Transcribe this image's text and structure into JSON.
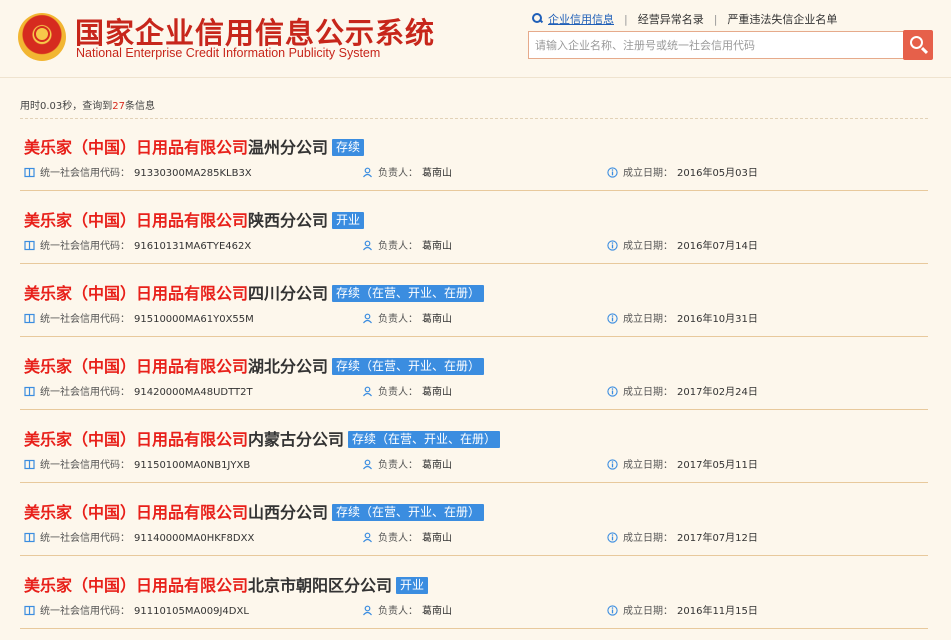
{
  "header": {
    "title_cn": "国家企业信用信息公示系统",
    "title_en": "National Enterprise Credit Information Publicity System",
    "nav": [
      "企业信用信息",
      "经营异常名录",
      "严重违法失信企业名单"
    ],
    "search_placeholder": "请输入企业名称、注册号或统一社会信用代码"
  },
  "stats": {
    "prefix": "用时0.03秒，查询到",
    "count": "27",
    "suffix": "条信息"
  },
  "labels": {
    "code": "统一社会信用代码：",
    "person": "负责人：",
    "date": "成立日期："
  },
  "results": [
    {
      "name_hl": "美乐家（中国）日用品有限公司",
      "name_rest": "温州分公司",
      "status": "存续",
      "code": "91330300MA285KLB3X",
      "person": "葛南山",
      "date": "2016年05月03日"
    },
    {
      "name_hl": "美乐家（中国）日用品有限公司",
      "name_rest": "陕西分公司",
      "status": "开业",
      "code": "91610131MA6TYE462X",
      "person": "葛南山",
      "date": "2016年07月14日"
    },
    {
      "name_hl": "美乐家（中国）日用品有限公司",
      "name_rest": "四川分公司",
      "status": "存续（在营、开业、在册）",
      "code": "91510000MA61Y0X55M",
      "person": "葛南山",
      "date": "2016年10月31日"
    },
    {
      "name_hl": "美乐家（中国）日用品有限公司",
      "name_rest": "湖北分公司",
      "status": "存续（在营、开业、在册）",
      "code": "91420000MA48UDTT2T",
      "person": "葛南山",
      "date": "2017年02月24日"
    },
    {
      "name_hl": "美乐家（中国）日用品有限公司",
      "name_rest": "内蒙古分公司",
      "status": "存续（在营、开业、在册）",
      "code": "91150100MA0NB1JYXB",
      "person": "葛南山",
      "date": "2017年05月11日"
    },
    {
      "name_hl": "美乐家（中国）日用品有限公司",
      "name_rest": "山西分公司",
      "status": "存续（在营、开业、在册）",
      "code": "91140000MA0HKF8DXX",
      "person": "葛南山",
      "date": "2017年07月12日"
    },
    {
      "name_hl": "美乐家（中国）日用品有限公司",
      "name_rest": "北京市朝阳区分公司",
      "status": "开业",
      "code": "91110105MA009J4DXL",
      "person": "葛南山",
      "date": "2016年11月15日"
    }
  ],
  "colors": {
    "accent_red": "#e8201a",
    "badge_blue": "#3b8de0",
    "link_blue": "#1f5fb8"
  }
}
